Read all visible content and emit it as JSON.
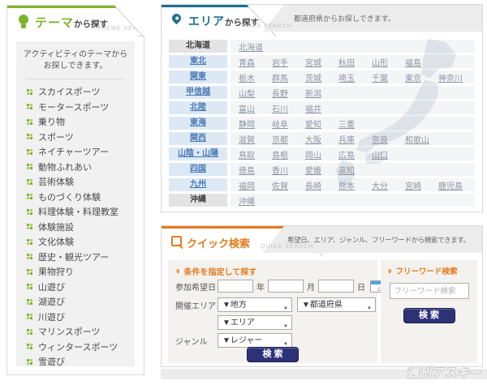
{
  "watermark": "週刊アスキー",
  "icons": {
    "chevron_down": "∨",
    "select_arrow": "▼",
    "calendar_day": "12"
  },
  "theme_panel": {
    "title_main": "テーマ",
    "title_suffix": "から探す",
    "title_en": "THEME SEARCH",
    "description_line1": "アクティビティのテーマから",
    "description_line2": "お探しできます。",
    "accent_color": "#7db427",
    "items": [
      "スカイスポーツ",
      "モータースポーツ",
      "乗り物",
      "スポーツ",
      "ネイチャーツアー",
      "動物ふれあい",
      "芸術体験",
      "ものづくり体験",
      "料理体験・料理教室",
      "体験施設",
      "文化体験",
      "歴史・観光ツアー",
      "果物狩り",
      "山遊び",
      "湖遊び",
      "川遊び",
      "マリンスポーツ",
      "ウィンタースポーツ",
      "雪遊び"
    ]
  },
  "area_panel": {
    "title_main": "エリア",
    "title_suffix": "から探す",
    "title_en": "AREA SEARCH",
    "note": "都道府県からお探しできます。",
    "accent_color": "#1d7090",
    "regions": [
      {
        "name": "北海道",
        "link": false,
        "prefectures": [
          "北海道"
        ]
      },
      {
        "name": "東北",
        "link": true,
        "prefectures": [
          "青森",
          "岩手",
          "宮城",
          "秋田",
          "山形",
          "福島"
        ]
      },
      {
        "name": "関東",
        "link": true,
        "prefectures": [
          "栃木",
          "群馬",
          "茨城",
          "埼玉",
          "千葉",
          "東京",
          "神奈川"
        ]
      },
      {
        "name": "甲信越",
        "link": true,
        "prefectures": [
          "山梨",
          "長野",
          "新潟"
        ]
      },
      {
        "name": "北陸",
        "link": true,
        "prefectures": [
          "富山",
          "石川",
          "福井"
        ]
      },
      {
        "name": "東海",
        "link": true,
        "prefectures": [
          "静岡",
          "岐阜",
          "愛知",
          "三重"
        ]
      },
      {
        "name": "関西",
        "link": true,
        "prefectures": [
          "滋賀",
          "京都",
          "大阪",
          "兵庫",
          "奈良",
          "和歌山"
        ]
      },
      {
        "name": "山陰・山陽",
        "link": true,
        "prefectures": [
          "鳥取",
          "島根",
          "岡山",
          "広島",
          "山口"
        ]
      },
      {
        "name": "四国",
        "link": true,
        "prefectures": [
          "徳島",
          "香川",
          "愛媛",
          "高知"
        ]
      },
      {
        "name": "九州",
        "link": true,
        "prefectures": [
          "福岡",
          "佐賀",
          "長崎",
          "熊本",
          "大分",
          "宮崎",
          "鹿児島"
        ]
      },
      {
        "name": "沖縄",
        "link": false,
        "prefectures": [
          "沖縄"
        ]
      }
    ]
  },
  "quick_panel": {
    "title_main": "クイック検索",
    "title_en": "QUICK SEARCH",
    "note": "希望日、エリア、ジャンル、フリーワードから検索できます。",
    "accent_color": "#e57a1c",
    "condition_section": {
      "heading": "条件を指定して探す",
      "date_label": "参加希望日",
      "unit_year": "年",
      "unit_month": "月",
      "unit_day": "日",
      "area_label": "開催エリア",
      "genre_label": "ジャンル",
      "select_region": "▼地方",
      "select_prefecture": "▼都道府県",
      "select_area": "▼エリア",
      "select_genre": "▼レジャー",
      "search_button": "検 索"
    },
    "freeword_section": {
      "heading": "フリーワード検索",
      "placeholder": "フリーワード検索",
      "search_button": "検 索"
    }
  }
}
